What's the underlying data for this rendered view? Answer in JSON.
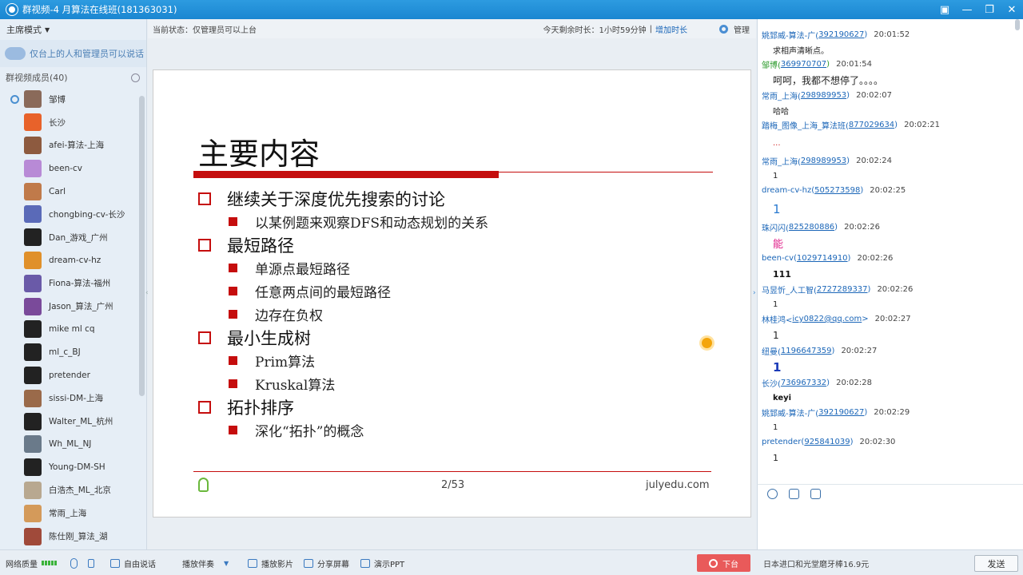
{
  "window": {
    "title": "群视频-4 月算法在线班(181363031)"
  },
  "left": {
    "mode_label": "主席模式",
    "speak_notice": "仅台上的人和管理员可以说话",
    "members_title": "群视频成员(40)",
    "members": [
      {
        "name": "邹博",
        "color": "#8a6a5a",
        "mic": true
      },
      {
        "name": "长沙",
        "color": "#e8622a",
        "mic": false
      },
      {
        "name": "afei-算法-上海",
        "color": "#8d5a3f",
        "mic": false
      },
      {
        "name": "been-cv",
        "color": "#b88ad6",
        "mic": false
      },
      {
        "name": "Carl",
        "color": "#c07a4a",
        "mic": false
      },
      {
        "name": "chongbing-cv-长沙",
        "color": "#5a6ab8",
        "mic": false
      },
      {
        "name": "Dan_游戏_广州",
        "color": "#222222",
        "mic": false
      },
      {
        "name": "dream-cv-hz",
        "color": "#e0902a",
        "mic": false
      },
      {
        "name": "Fiona-算法-福州",
        "color": "#6a5aa8",
        "mic": false
      },
      {
        "name": "Jason_算法_广州",
        "color": "#7a4a9a",
        "mic": false
      },
      {
        "name": "mike ml cq",
        "color": "#222222",
        "mic": false
      },
      {
        "name": "ml_c_BJ",
        "color": "#222222",
        "mic": false
      },
      {
        "name": "pretender",
        "color": "#222222",
        "mic": false
      },
      {
        "name": "sissi-DM-上海",
        "color": "#9a6a4a",
        "mic": false
      },
      {
        "name": "Walter_ML_杭州",
        "color": "#222222",
        "mic": false
      },
      {
        "name": "Wh_ML_NJ",
        "color": "#6a7a8a",
        "mic": false
      },
      {
        "name": "Young-DM-SH",
        "color": "#222222",
        "mic": false
      },
      {
        "name": "白浩杰_ML_北京",
        "color": "#b8a890",
        "mic": false
      },
      {
        "name": "常雨_上海",
        "color": "#d49a5a",
        "mic": false
      },
      {
        "name": "陈仕刚_算法_湖",
        "color": "#a04a3a",
        "mic": false
      }
    ]
  },
  "header": {
    "status": "当前状态：仅管理员可以上台",
    "remaining": "今天剩余时长：1小时59分钟",
    "separator": "|",
    "add_time": "增加时长",
    "manage": "管理"
  },
  "slide": {
    "title": "主要内容",
    "items": [
      {
        "level": 1,
        "text": "继续关于深度优先搜索的讨论"
      },
      {
        "level": 2,
        "text": "以某例题来观察DFS和动态规划的关系"
      },
      {
        "level": 1,
        "text": "最短路径"
      },
      {
        "level": 2,
        "text": "单源点最短路径"
      },
      {
        "level": 2,
        "text": "任意两点间的最短路径"
      },
      {
        "level": 2,
        "text": "边存在负权"
      },
      {
        "level": 1,
        "text": "最小生成树"
      },
      {
        "level": 2,
        "text": "Prim算法"
      },
      {
        "level": 2,
        "text": "Kruskal算法"
      },
      {
        "level": 1,
        "text": "拓扑排序"
      },
      {
        "level": 2,
        "text": "深化“拓扑”的概念"
      }
    ],
    "page": "2/53",
    "site": "julyedu.com"
  },
  "chat": {
    "messages": [
      {
        "name": "姚郅威-算法-广(",
        "num": "392190627",
        "close": ")",
        "time": "20:01:52",
        "text": "求相声清晰点。",
        "color": "#222222",
        "size": 10,
        "bold": false,
        "name_color": "#1b66b8"
      },
      {
        "name": "邹博(",
        "num": "369970707",
        "close": ")",
        "time": "20:01:54",
        "text": "呵呵，我都不想停了。。。。",
        "color": "#222222",
        "size": 12,
        "bold": false,
        "name_color": "#2a9a2a"
      },
      {
        "name": "常雨_上海(",
        "num": "298989953",
        "close": ")",
        "time": "20:02:07",
        "text": "哈哈",
        "color": "#222222",
        "size": 10,
        "bold": false,
        "name_color": "#1b66b8"
      },
      {
        "name": "踏梅_图像_上海_算法班(",
        "num": "877029634",
        "close": ")",
        "time": "20:02:21",
        "text": "...",
        "color": "#d22222",
        "size": 10,
        "bold": false,
        "name_color": "#1b66b8"
      },
      {
        "name": "常雨_上海(",
        "num": "298989953",
        "close": ")",
        "time": "20:02:24",
        "text": "1",
        "color": "#222222",
        "size": 10,
        "bold": false,
        "name_color": "#1b66b8"
      },
      {
        "name": "dream-cv-hz(",
        "num": "505273598",
        "close": ")",
        "time": "20:02:25",
        "text": "1",
        "color": "#2a7ad0",
        "size": 15,
        "bold": false,
        "name_color": "#1b66b8"
      },
      {
        "name": "珠闪闪(",
        "num": "825280886",
        "close": ")",
        "time": "20:02:26",
        "text": "能",
        "color": "#e0208a",
        "size": 13,
        "bold": false,
        "name_color": "#1b66b8"
      },
      {
        "name": "been-cv(",
        "num": "1029714910",
        "close": ")",
        "time": "20:02:26",
        "text": "111",
        "color": "#111111",
        "size": 11,
        "bold": true,
        "name_color": "#1b66b8"
      },
      {
        "name": "马昱忻_人工智(",
        "num": "2727289337",
        "close": ")",
        "time": "20:02:26",
        "text": "1",
        "color": "#222222",
        "size": 10,
        "bold": false,
        "name_color": "#1b66b8"
      },
      {
        "name": "林桂鸿<",
        "num": "icy0822@qq.com",
        "close": ">",
        "time": "20:02:27",
        "text": "1",
        "color": "#222222",
        "size": 12,
        "bold": false,
        "name_color": "#1b66b8"
      },
      {
        "name": "纽曼(",
        "num": "1196647359",
        "close": ")",
        "time": "20:02:27",
        "text": "1",
        "color": "#1a3ab8",
        "size": 15,
        "bold": true,
        "name_color": "#1b66b8"
      },
      {
        "name": "长沙(",
        "num": "736967332",
        "close": ")",
        "time": "20:02:28",
        "text": "keyi",
        "color": "#111111",
        "size": 10,
        "bold": true,
        "name_color": "#1b66b8"
      },
      {
        "name": "姚郅威-算法-广(",
        "num": "392190627",
        "close": ")",
        "time": "20:02:29",
        "text": "1",
        "color": "#222222",
        "size": 10,
        "bold": false,
        "name_color": "#1b66b8"
      },
      {
        "name": "pretender(",
        "num": "925841039",
        "close": ")",
        "time": "20:02:30",
        "text": "1",
        "color": "#222222",
        "size": 11,
        "bold": false,
        "name_color": "#1b66b8"
      }
    ],
    "ad": "日本进口和光堂磨牙棒16.9元",
    "send": "发送"
  },
  "bottom": {
    "network_label": "网络质量",
    "free_talk": "自由说话",
    "accompany": "播放伴奏",
    "play_video": "播放影片",
    "share_screen": "分享屏幕",
    "show_ppt": "演示PPT",
    "leave_stage": "下台"
  }
}
